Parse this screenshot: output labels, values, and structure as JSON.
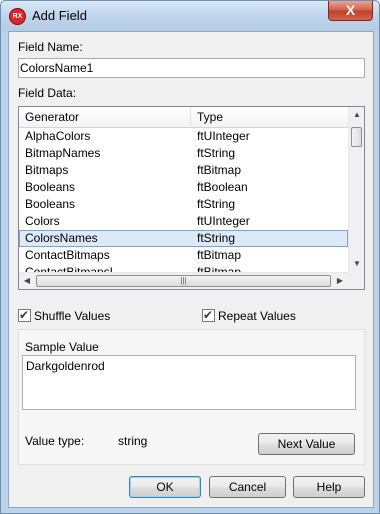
{
  "window": {
    "title": "Add Field",
    "icon_text": "RX",
    "close_glyph": "X"
  },
  "field_name": {
    "label": "Field Name:",
    "value": "ColorsName1"
  },
  "field_data": {
    "label": "Field Data:",
    "columns": [
      "Generator",
      "Type"
    ],
    "rows": [
      [
        "AlphaColors",
        "ftUInteger"
      ],
      [
        "BitmapNames",
        "ftString"
      ],
      [
        "Bitmaps",
        "ftBitmap"
      ],
      [
        "Booleans",
        "ftBoolean"
      ],
      [
        "Booleans",
        "ftString"
      ],
      [
        "Colors",
        "ftUInteger"
      ],
      [
        "ColorsNames",
        "ftString"
      ],
      [
        "ContactBitmaps",
        "ftBitmap"
      ],
      [
        "ContactBitmapsL",
        "ftBitmap"
      ]
    ],
    "selected_index": 6
  },
  "options": {
    "shuffle": {
      "label": "Shuffle Values",
      "checked": true
    },
    "repeat": {
      "label": "Repeat Values",
      "checked": true
    }
  },
  "sample": {
    "label": "Sample Value",
    "value": "Darkgoldenrod",
    "type_label": "Value type:",
    "type_value": "string",
    "next_button": "Next Value"
  },
  "buttons": {
    "ok": "OK",
    "cancel": "Cancel",
    "help": "Help"
  }
}
